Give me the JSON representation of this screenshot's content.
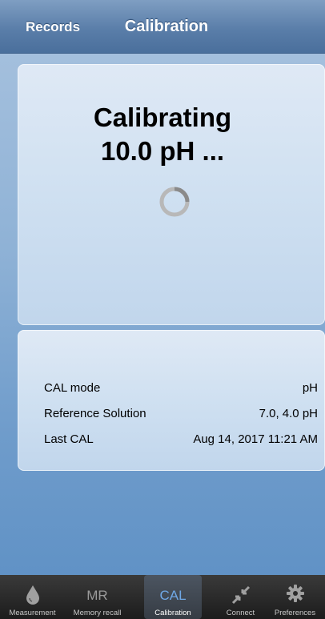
{
  "navbar": {
    "left_label": "Records",
    "title": "Calibration"
  },
  "status": {
    "line1": "Calibrating",
    "line2": "10.0 pH ..."
  },
  "info": {
    "rows": [
      {
        "label": "CAL mode",
        "value": "pH"
      },
      {
        "label": "Reference Solution",
        "value": "7.0, 4.0 pH"
      },
      {
        "label": "Last CAL",
        "value": "Aug 14, 2017  11:21 AM"
      }
    ]
  },
  "tabs": [
    {
      "label": "Measurement",
      "icon": "droplet-icon"
    },
    {
      "label": "Memory recall",
      "icon_text": "MR"
    },
    {
      "label": "Calibration",
      "icon_text": "CAL",
      "active": true
    },
    {
      "label": "Connect",
      "icon": "connect-arrows-icon"
    },
    {
      "label": "Preferences",
      "icon": "gear-icon"
    }
  ],
  "colors": {
    "accent": "#6fa8e6",
    "navbar": "#5a7ea9",
    "tabbar": "#1c1c1c"
  }
}
